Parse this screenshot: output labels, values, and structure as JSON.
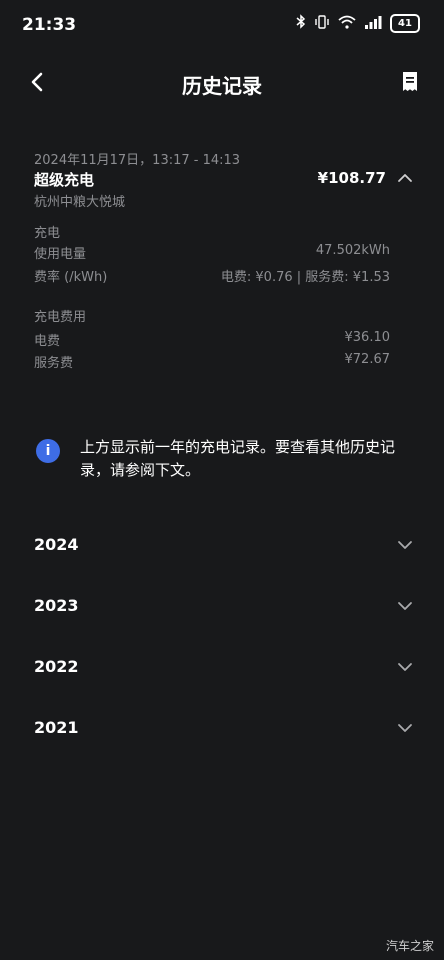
{
  "status_bar": {
    "time": "21:33",
    "battery": "41"
  },
  "header": {
    "title": "历史记录"
  },
  "record": {
    "date": "2024年11月17日，13:17 - 14:13",
    "type": "超级充电",
    "location": "杭州中粮大悦城",
    "total": "¥108.77",
    "charging": {
      "section_label": "充电",
      "usage_label": "使用电量",
      "usage_value": "47.502kWh",
      "rate_label": "费率 (/kWh)",
      "rate_value": "电费: ¥0.76 | 服务费: ¥1.53"
    },
    "fees": {
      "section_label": "充电费用",
      "electricity_label": "电费",
      "electricity_value": "¥36.10",
      "service_label": "服务费",
      "service_value": "¥72.67"
    }
  },
  "info": {
    "text": "上方显示前一年的充电记录。要查看其他历史记录，请参阅下文。"
  },
  "years": [
    "2024",
    "2023",
    "2022",
    "2021"
  ],
  "watermark": "汽车之家"
}
